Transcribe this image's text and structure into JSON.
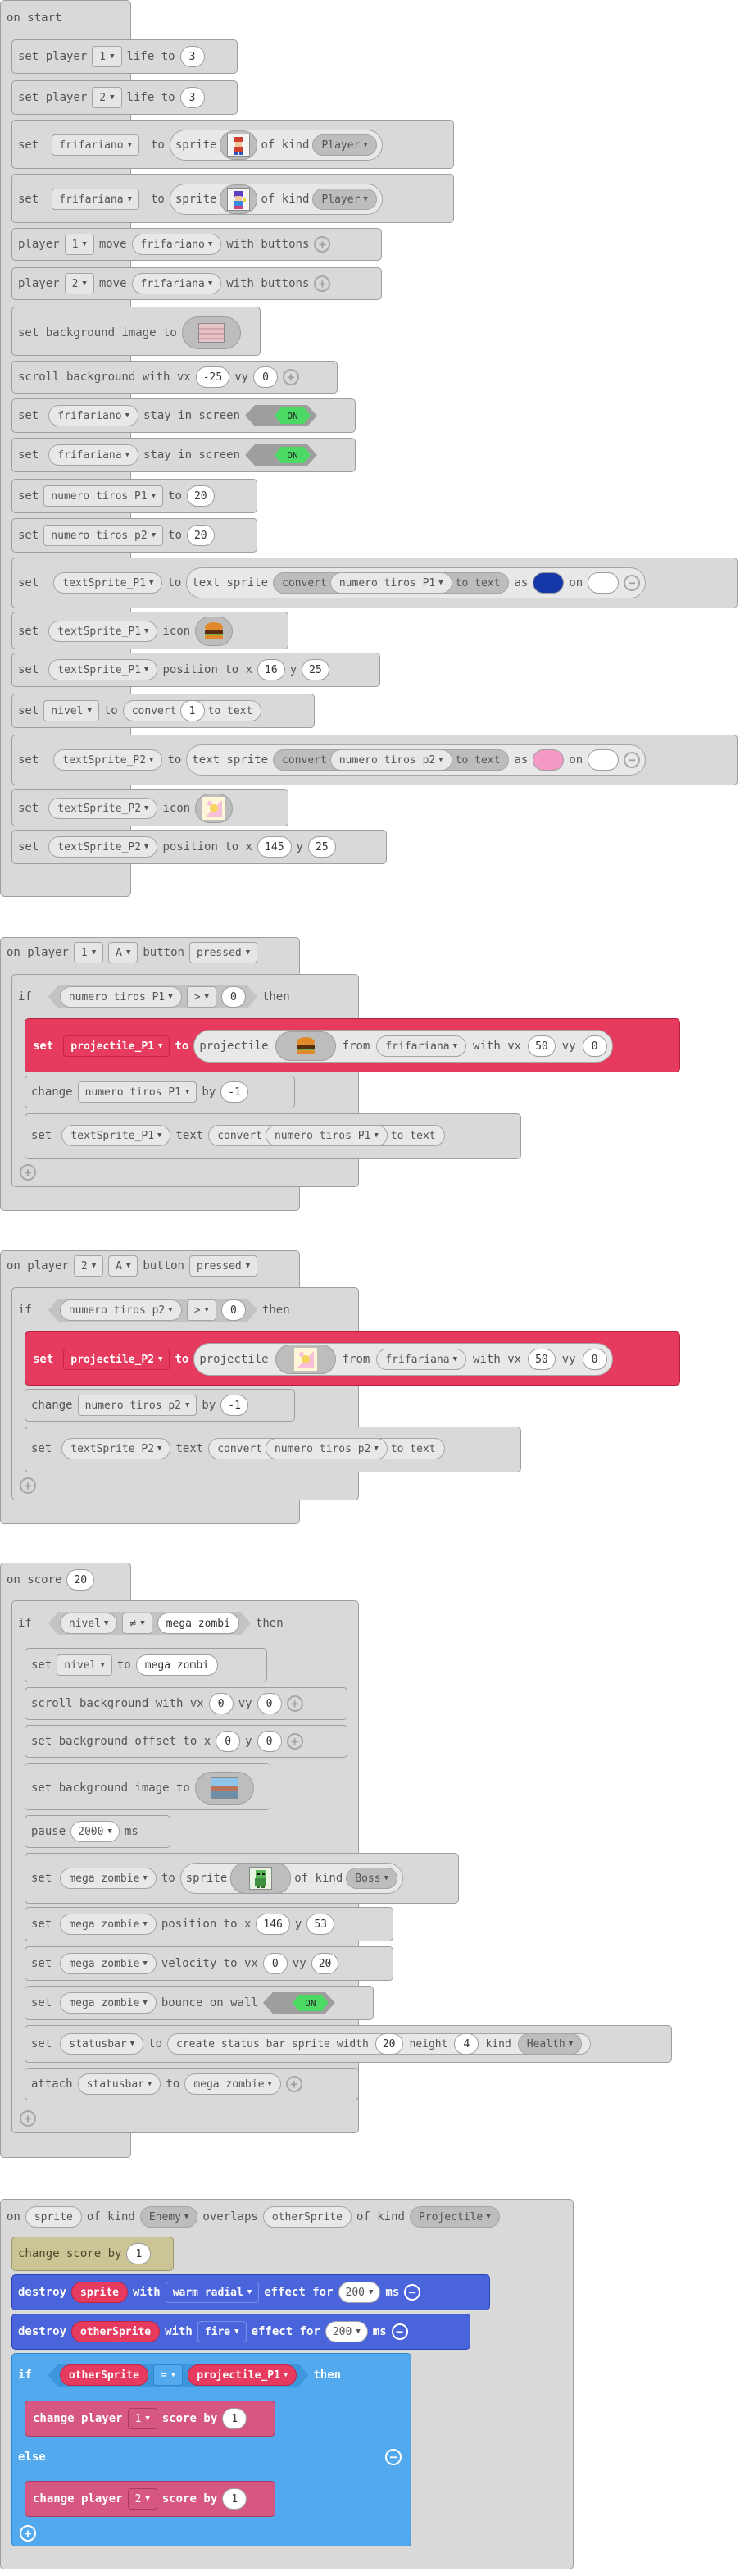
{
  "on_start": {
    "hat": "on start",
    "rows": {
      "p1life": {
        "set": "set player",
        "player": "1",
        "life_to": "life to",
        "value": "3"
      },
      "p2life": {
        "set": "set player",
        "player": "2",
        "life_to": "life to",
        "value": "3"
      },
      "spr1": {
        "set": "set",
        "var": "frifariano",
        "to": "to",
        "sprite": "sprite",
        "of_kind": "of kind",
        "kind": "Player"
      },
      "spr2": {
        "set": "set",
        "var": "frifariana",
        "to": "to",
        "sprite": "sprite",
        "of_kind": "of kind",
        "kind": "Player"
      },
      "mv1": {
        "player": "player",
        "num": "1",
        "move": "move",
        "var": "frifariano",
        "with_buttons": "with buttons"
      },
      "mv2": {
        "player": "player",
        "num": "2",
        "move": "move",
        "var": "frifariana",
        "with_buttons": "with buttons"
      },
      "bgimg": {
        "label": "set background image to"
      },
      "scroll": {
        "label": "scroll background with vx",
        "vx": "-25",
        "vy_label": "vy",
        "vy": "0"
      },
      "stay1": {
        "set": "set",
        "var": "frifariano",
        "label": "stay in screen",
        "toggle": "ON"
      },
      "stay2": {
        "set": "set",
        "var": "frifariana",
        "label": "stay in screen",
        "toggle": "ON"
      },
      "n1": {
        "set": "set",
        "var": "numero tiros P1",
        "to": "to",
        "value": "20"
      },
      "n2": {
        "set": "set",
        "var": "numero tiros p2",
        "to": "to",
        "value": "20"
      },
      "ts1": {
        "set": "set",
        "var": "textSprite_P1",
        "to": "to",
        "text_sprite": "text sprite",
        "convert": "convert",
        "src": "numero tiros P1",
        "to_text": "to text",
        "as": "as",
        "on": "on",
        "fg": "#1637a8",
        "bg": "#ffffff"
      },
      "ic1": {
        "set": "set",
        "var": "textSprite_P1",
        "icon": "icon"
      },
      "pos1": {
        "set": "set",
        "var": "textSprite_P1",
        "label": "position to x",
        "x": "16",
        "y_label": "y",
        "y": "25"
      },
      "nivel": {
        "set": "set",
        "var": "nivel",
        "to": "to",
        "convert": "convert",
        "value": "1",
        "to_text": "to text"
      },
      "ts2": {
        "set": "set",
        "var": "textSprite_P2",
        "to": "to",
        "text_sprite": "text sprite",
        "convert": "convert",
        "src": "numero tiros p2",
        "to_text": "to text",
        "as": "as",
        "on": "on",
        "fg": "#f59ac5",
        "bg": "#ffffff"
      },
      "ic2": {
        "set": "set",
        "var": "textSprite_P2",
        "icon": "icon"
      },
      "pos2": {
        "set": "set",
        "var": "textSprite_P2",
        "label": "position to x",
        "x": "145",
        "y_label": "y",
        "y": "25"
      }
    }
  },
  "btn_a1": {
    "hat": {
      "on": "on player",
      "player": "1",
      "button": "A",
      "btn_label": "button",
      "event": "pressed"
    },
    "if": {
      "if": "if",
      "var": "numero tiros P1",
      "op": ">",
      "value": "0",
      "then": "then"
    },
    "proj": {
      "set": "set",
      "var": "projectile_P1",
      "to": "to",
      "projectile": "projectile",
      "from": "from",
      "src": "frifariana",
      "with_vx": "with vx",
      "vx": "50",
      "vy_label": "vy",
      "vy": "0"
    },
    "change": {
      "change": "change",
      "var": "numero tiros P1",
      "by": "by",
      "value": "-1"
    },
    "settext": {
      "set": "set",
      "var": "textSprite_P1",
      "text": "text",
      "convert": "convert",
      "src": "numero tiros P1",
      "to_text": "to text"
    }
  },
  "btn_a2": {
    "hat": {
      "on": "on player",
      "player": "2",
      "button": "A",
      "btn_label": "button",
      "event": "pressed"
    },
    "if": {
      "if": "if",
      "var": "numero tiros p2",
      "op": ">",
      "value": "0",
      "then": "then"
    },
    "proj": {
      "set": "set",
      "var": "projectile_P2",
      "to": "to",
      "projectile": "projectile",
      "from": "from",
      "src": "frifariana",
      "with_vx": "with vx",
      "vx": "50",
      "vy_label": "vy",
      "vy": "0"
    },
    "change": {
      "change": "change",
      "var": "numero tiros p2",
      "by": "by",
      "value": "-1"
    },
    "settext": {
      "set": "set",
      "var": "textSprite_P2",
      "text": "text",
      "convert": "convert",
      "src": "numero tiros p2",
      "to_text": "to text"
    }
  },
  "on_score": {
    "hat": {
      "label": "on score",
      "value": "20"
    },
    "if": {
      "if": "if",
      "var": "nivel",
      "op": "≠",
      "value": "mega zombi",
      "then": "then"
    },
    "set_nivel": {
      "set": "set",
      "var": "nivel",
      "to": "to",
      "value": "mega zombi"
    },
    "scroll": {
      "label": "scroll background with vx",
      "vx": "0",
      "vy_label": "vy",
      "vy": "0"
    },
    "offset": {
      "label": "set background offset to x",
      "x": "0",
      "y_label": "y",
      "y": "0"
    },
    "bgimg": {
      "label": "set background image to"
    },
    "pause": {
      "label": "pause",
      "value": "2000",
      "unit": "ms"
    },
    "spr": {
      "set": "set",
      "var": "mega zombie",
      "to": "to",
      "sprite": "sprite",
      "of_kind": "of kind",
      "kind": "Boss"
    },
    "pos": {
      "set": "set",
      "var": "mega zombie",
      "label": "position to x",
      "x": "146",
      "y_label": "y",
      "y": "53"
    },
    "vel": {
      "set": "set",
      "var": "mega zombie",
      "label": "velocity to vx",
      "vx": "0",
      "vy_label": "vy",
      "vy": "20"
    },
    "bounce": {
      "set": "set",
      "var": "mega zombie",
      "label": "bounce on wall",
      "toggle": "ON"
    },
    "statusbar": {
      "set": "set",
      "var": "statusbar",
      "to": "to",
      "create": "create status bar sprite width",
      "width": "20",
      "height_label": "height",
      "height": "4",
      "kind_label": "kind",
      "kind": "Health"
    },
    "attach": {
      "attach": "attach",
      "var": "statusbar",
      "to": "to",
      "target": "mega zombie"
    }
  },
  "overlap": {
    "hat": {
      "on": "on",
      "sprite": "sprite",
      "of_kind": "of kind",
      "kind": "Enemy",
      "overlaps": "overlaps",
      "other": "otherSprite",
      "of_kind2": "of kind",
      "kind2": "Projectile"
    },
    "score": {
      "label": "change score by",
      "value": "1"
    },
    "d1": {
      "destroy": "destroy",
      "var": "sprite",
      "with": "with",
      "effect": "warm radial",
      "effect_for": "effect for",
      "ms_val": "200",
      "ms": "ms"
    },
    "d2": {
      "destroy": "destroy",
      "var": "otherSprite",
      "with": "with",
      "effect": "fire",
      "effect_for": "effect for",
      "ms_val": "200",
      "ms": "ms"
    },
    "if": {
      "if": "if",
      "var": "otherSprite",
      "op": "=",
      "value": "projectile_P1",
      "then": "then"
    },
    "c1": {
      "label": "change player",
      "player": "1",
      "score_by": "score by",
      "value": "1"
    },
    "else": "else",
    "c2": {
      "label": "change player",
      "player": "2",
      "score_by": "score by",
      "value": "1"
    }
  },
  "colors": {
    "block_gray": "#d9d9d9",
    "projectile_red": "#e63b5e",
    "info_olive": "#cbc596",
    "effects_blue": "#4a64dc",
    "logic_lightblue": "#52a9ee",
    "controller_pink": "#d65882",
    "toggle_green": "#4cd964"
  }
}
